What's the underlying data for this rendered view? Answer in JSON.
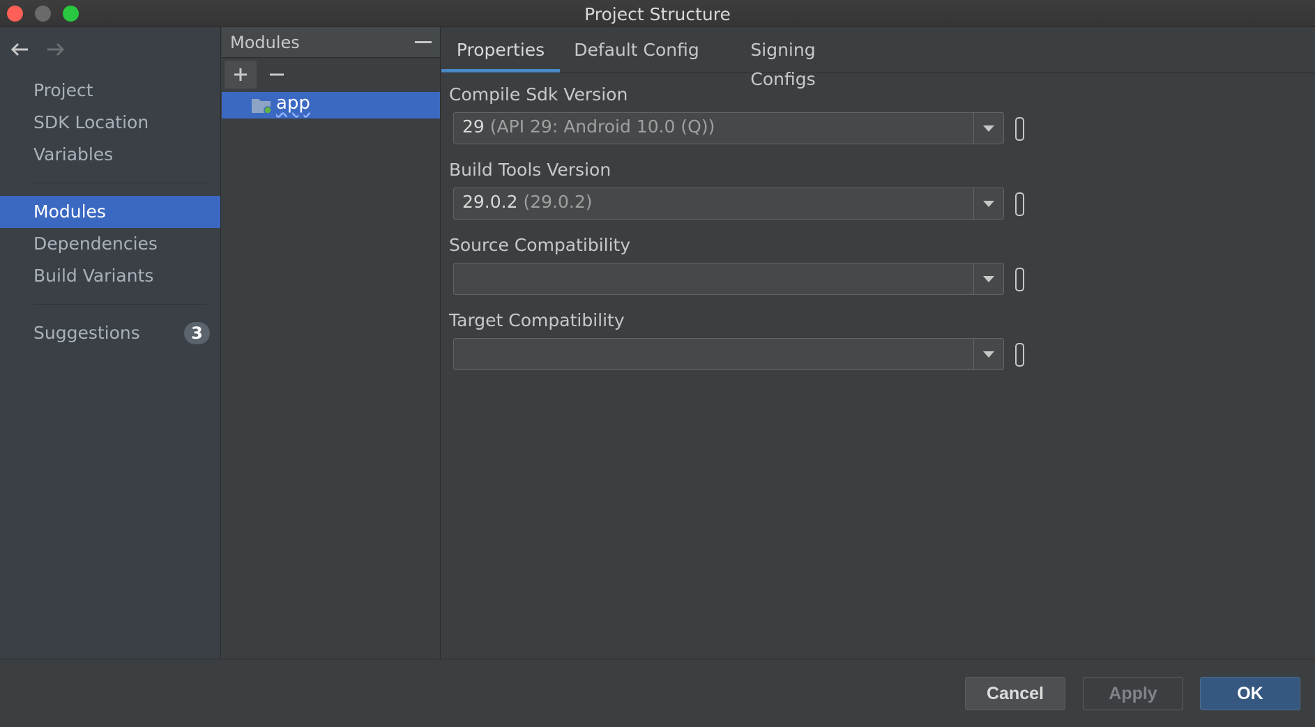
{
  "window": {
    "title": "Project Structure"
  },
  "nav": {
    "items": [
      {
        "label": "Project"
      },
      {
        "label": "SDK Location"
      },
      {
        "label": "Variables"
      },
      {
        "label": "Modules",
        "selected": true
      },
      {
        "label": "Dependencies"
      },
      {
        "label": "Build Variants"
      },
      {
        "label": "Suggestions",
        "badge": "3"
      }
    ]
  },
  "modules": {
    "header": "Modules",
    "items": [
      {
        "name": "app",
        "icon": "module-folder-icon",
        "selected": true
      }
    ]
  },
  "tabs": [
    {
      "label": "Properties",
      "active": true
    },
    {
      "label": "Default Config"
    },
    {
      "label": "Signing Configs"
    }
  ],
  "fields": [
    {
      "label": "Compile Sdk Version",
      "value": "29",
      "hint": "(API 29: Android 10.0 (Q))"
    },
    {
      "label": "Build Tools Version",
      "value": "29.0.2",
      "hint": "(29.0.2)"
    },
    {
      "label": "Source Compatibility",
      "value": "",
      "hint": ""
    },
    {
      "label": "Target Compatibility",
      "value": "",
      "hint": ""
    }
  ],
  "buttons": {
    "cancel": "Cancel",
    "apply": "Apply",
    "ok": "OK"
  },
  "colors": {
    "selection": "#3b69c2",
    "tab_underline": "#4a88c7",
    "ok_button": "#365880"
  }
}
